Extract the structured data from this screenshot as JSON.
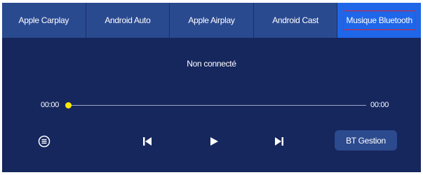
{
  "tabs": [
    {
      "label": "Apple Carplay",
      "active": false
    },
    {
      "label": "Android Auto",
      "active": false
    },
    {
      "label": "Apple Airplay",
      "active": false
    },
    {
      "label": "Android Cast",
      "active": false
    },
    {
      "label": "Musique Bluetooth",
      "active": true
    }
  ],
  "status": "Non connecté",
  "player": {
    "elapsed": "00:00",
    "total": "00:00",
    "progress": 0
  },
  "controls": {
    "playlist_icon": "playlist-icon",
    "previous_icon": "skip-previous-icon",
    "play_icon": "play-icon",
    "next_icon": "skip-next-icon",
    "bt_button_label": "BT Gestion"
  },
  "colors": {
    "background": "#16275e",
    "tab_bar": "#2a4a90",
    "active_tab": "#1f66e8",
    "active_outline": "#e0212d",
    "progress_knob": "#ffe800",
    "button": "#2c4a8e"
  }
}
